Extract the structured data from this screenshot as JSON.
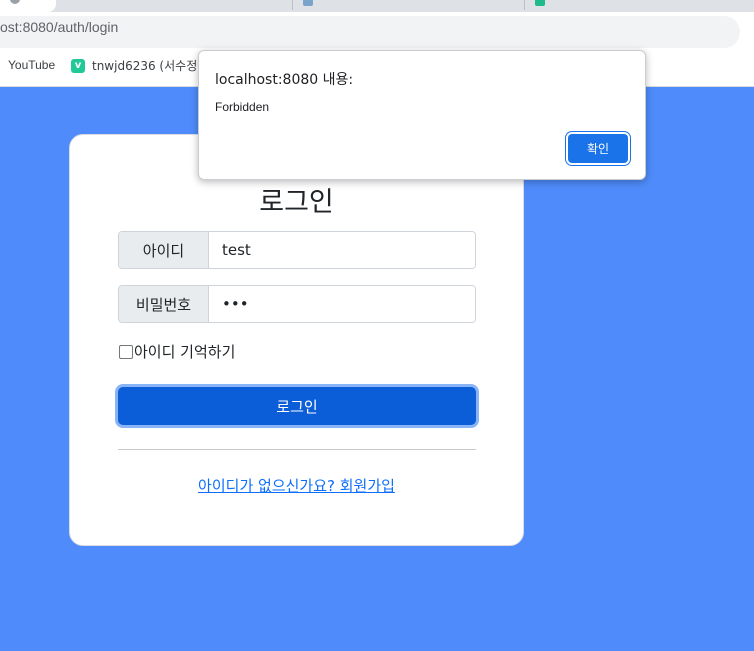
{
  "browser": {
    "url": "ost:8080/auth/login",
    "bookmarks": [
      {
        "label": "YouTube"
      },
      {
        "label": "tnwjd6236 (서수정)",
        "icon_letter": "v"
      }
    ]
  },
  "login": {
    "title": "로그인",
    "id_label": "아이디",
    "id_value": "test",
    "pw_label": "비밀번호",
    "pw_value": "abc",
    "remember_label": "아이디 기억하기",
    "remember_checked": false,
    "submit_label": "로그인",
    "signup_link": "아이디가 없으신가요? 회원가입"
  },
  "dialog": {
    "title": "localhost:8080 내용:",
    "message": "Forbidden",
    "ok_label": "확인"
  },
  "colors": {
    "page_background": "#4f8bfa",
    "primary_button": "#0b5ed7",
    "link": "#0d6efd",
    "dialog_button": "#1a73e8"
  }
}
